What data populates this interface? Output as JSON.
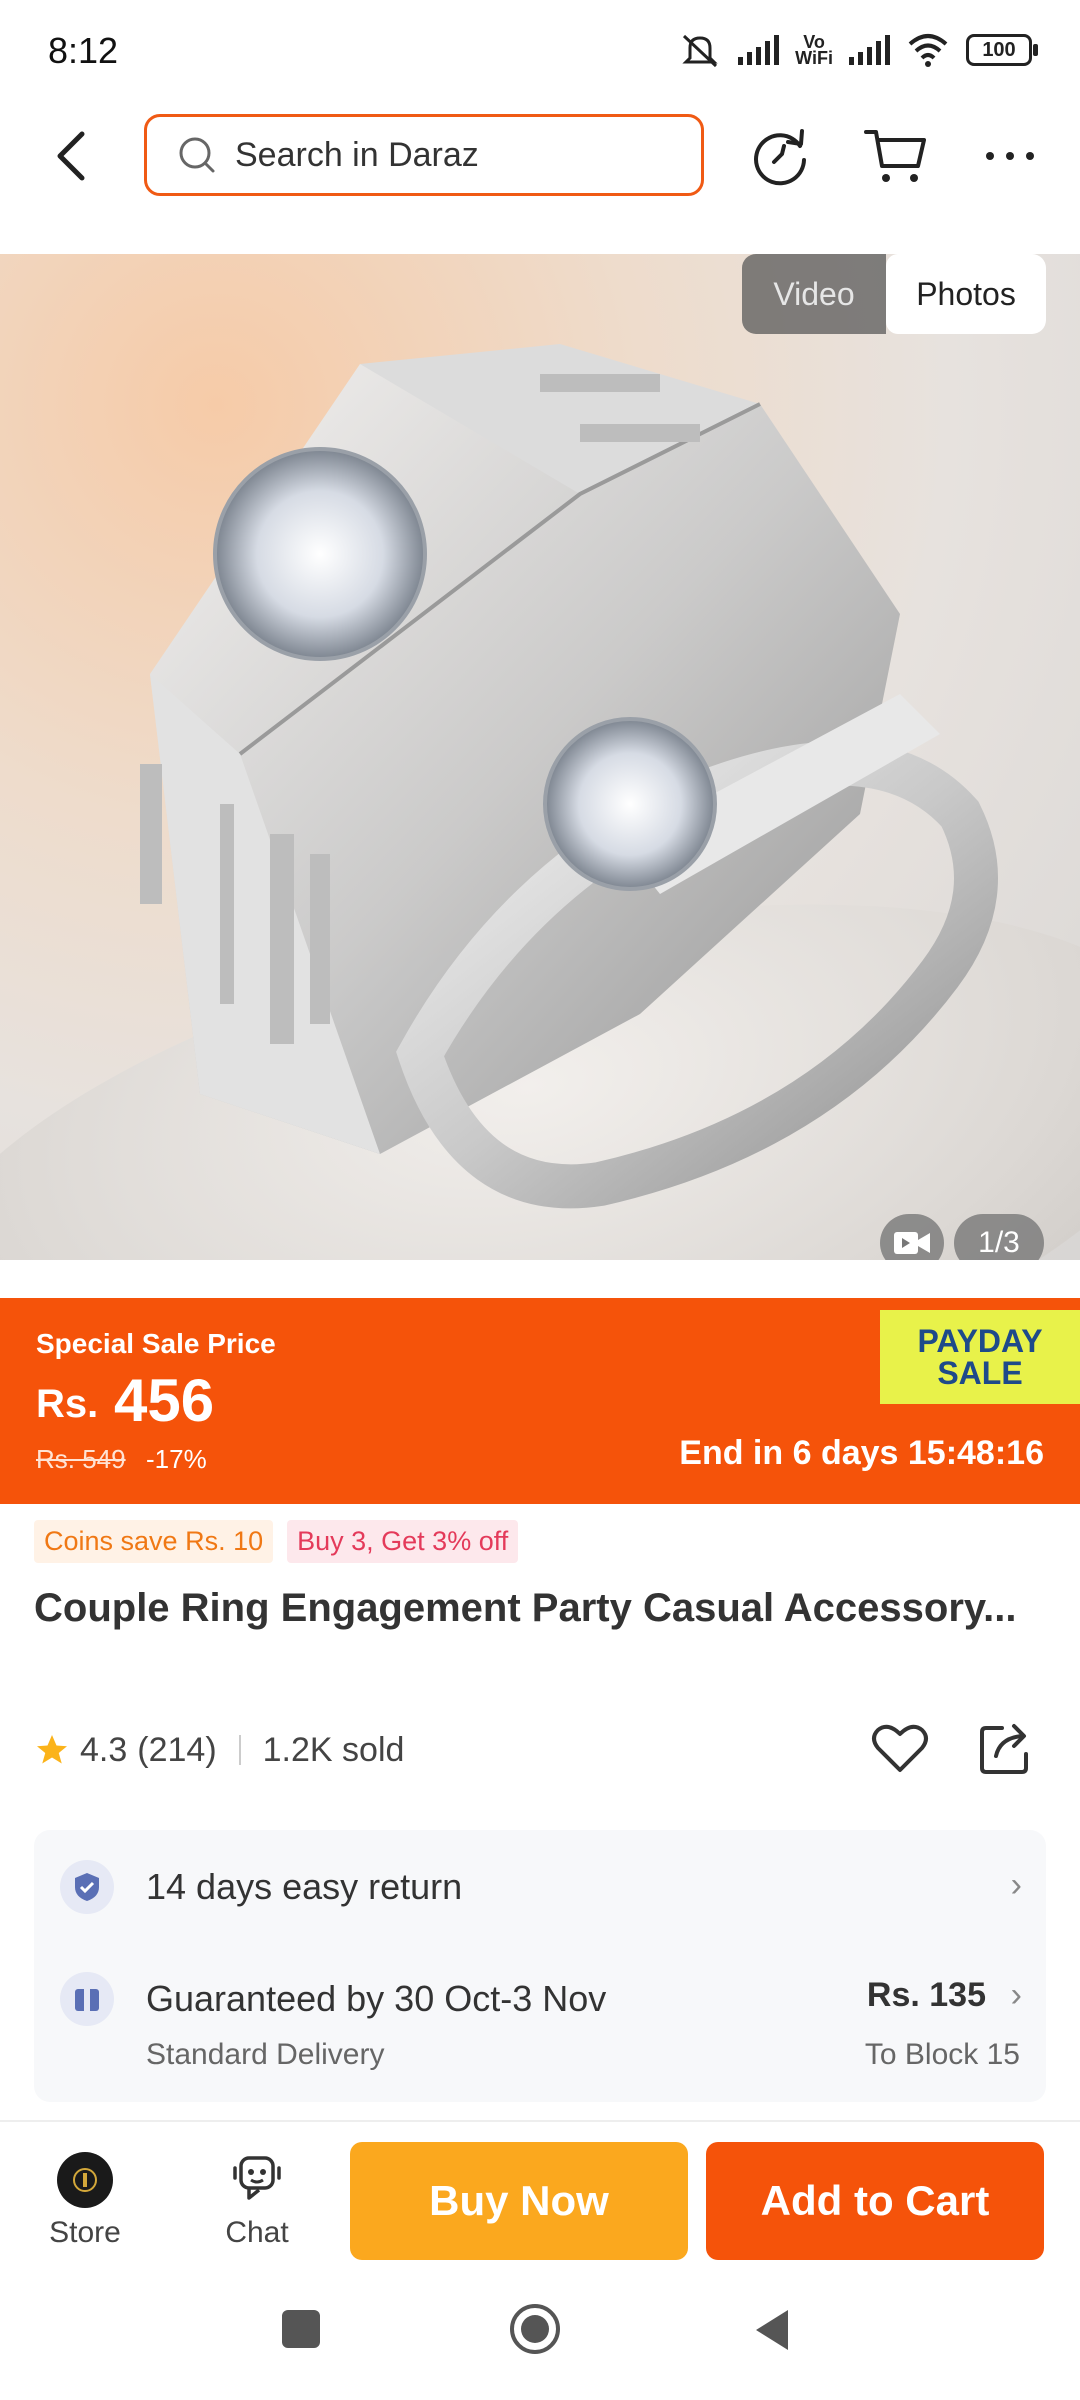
{
  "status_bar": {
    "time": "8:12",
    "vowifi_top": "Vo",
    "vowifi_bottom": "WiFi",
    "battery": "100"
  },
  "search": {
    "placeholder": "Search in Daraz"
  },
  "gallery": {
    "tab_video": "Video",
    "tab_photos": "Photos",
    "counter": "1/3"
  },
  "sale": {
    "label": "Special Sale Price",
    "currency": "Rs.",
    "price": "456",
    "original_price": "Rs. 549",
    "discount": "-17%",
    "badge_line1": "PAYDAY",
    "badge_line2": "SALE",
    "countdown": "End in 6 days 15:48:16"
  },
  "tags": {
    "coins": "Coins save Rs. 10",
    "buy3": "Buy 3, Get 3% off"
  },
  "product": {
    "title": "Couple Ring  Engagement Party Casual Accessory...",
    "rating": "4.3",
    "reviews": "(214)",
    "sold": "1.2K sold"
  },
  "service": {
    "return_text": "14 days easy return",
    "delivery_title": "Guaranteed by 30 Oct-3 Nov",
    "delivery_sub": "Standard Delivery",
    "delivery_price": "Rs. 135",
    "delivery_dest": "To Block 15"
  },
  "bottom_bar": {
    "store": "Store",
    "chat": "Chat",
    "buy_now": "Buy Now",
    "add_to_cart": "Add to Cart"
  },
  "colors": {
    "accent": "#f5530a",
    "buy_now": "#fba81e",
    "search_border": "#f05a14",
    "payday_badge": "#e8f24a"
  }
}
